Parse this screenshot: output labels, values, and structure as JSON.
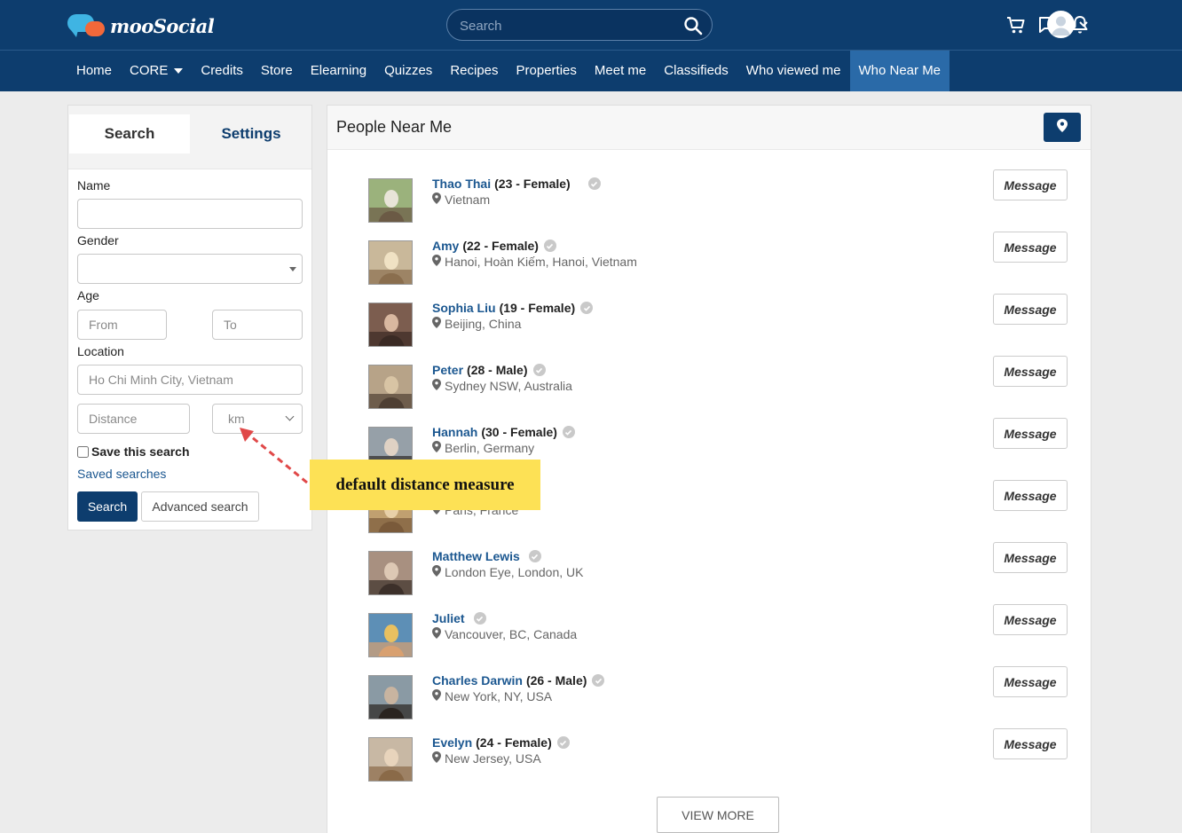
{
  "header": {
    "logo_text": "mooSocial",
    "search_placeholder": "Search",
    "icons": [
      "cart-icon",
      "chat-icon",
      "bell-icon",
      "user-avatar"
    ]
  },
  "nav": {
    "items": [
      {
        "label": "Home"
      },
      {
        "label": "CORE",
        "dropdown": true
      },
      {
        "label": "Credits"
      },
      {
        "label": "Store"
      },
      {
        "label": "Elearning"
      },
      {
        "label": "Quizzes"
      },
      {
        "label": "Recipes"
      },
      {
        "label": "Properties"
      },
      {
        "label": "Meet me"
      },
      {
        "label": "Classifieds"
      },
      {
        "label": "Who viewed me"
      },
      {
        "label": "Who Near Me",
        "active": true
      }
    ]
  },
  "sidebar": {
    "tabs": {
      "search": "Search",
      "settings": "Settings"
    },
    "name_label": "Name",
    "name_value": "",
    "gender_label": "Gender",
    "gender_value": "",
    "age_label": "Age",
    "age_from_placeholder": "From",
    "age_to_placeholder": "To",
    "location_label": "Location",
    "location_placeholder": "Ho Chi Minh City, Vietnam",
    "distance_placeholder": "Distance",
    "unit_value": "km",
    "save_search_label": "Save this search",
    "saved_searches_link": "Saved searches",
    "search_button": "Search",
    "advanced_search_button": "Advanced search"
  },
  "annotation": {
    "text": "default distance measure"
  },
  "main": {
    "title": "People Near Me",
    "message_label": "Message",
    "view_more": "VIEW MORE",
    "people": [
      {
        "name": "Thao Thai",
        "meta": "(23 - Female)",
        "location": "Vietnam"
      },
      {
        "name": "Amy",
        "meta": "(22 - Female)",
        "location": "Hanoi, Hoàn Kiếm, Hanoi, Vietnam"
      },
      {
        "name": "Sophia Liu",
        "meta": "(19 - Female)",
        "location": "Beijing, China"
      },
      {
        "name": "Peter",
        "meta": "(28 - Male)",
        "location": "Sydney NSW, Australia"
      },
      {
        "name": "Hannah",
        "meta": "(30 - Female)",
        "location": "Berlin, Germany"
      },
      {
        "name": "",
        "meta": ")",
        "location": "Paris, France"
      },
      {
        "name": "Matthew Lewis",
        "meta": "",
        "location": "London Eye, London, UK"
      },
      {
        "name": "Juliet",
        "meta": "",
        "location": "Vancouver, BC, Canada"
      },
      {
        "name": "Charles Darwin",
        "meta": "(26 - Male)",
        "location": "New York, NY, USA"
      },
      {
        "name": "Evelyn",
        "meta": "(24 - Female)",
        "location": "New Jersey, USA"
      }
    ]
  }
}
